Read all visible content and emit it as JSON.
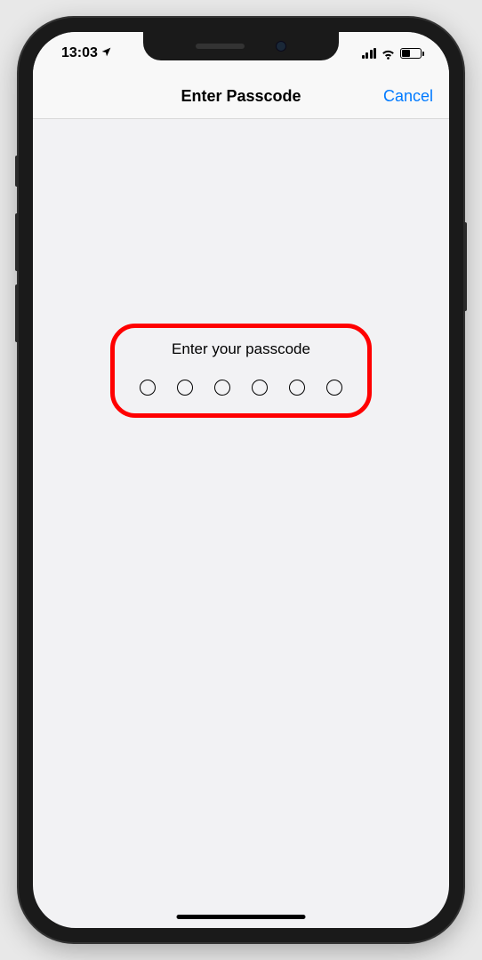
{
  "status_bar": {
    "time": "13:03",
    "location_icon": "location-arrow",
    "signal_icon": "cellular-signal",
    "wifi_icon": "wifi",
    "battery_icon": "battery-half"
  },
  "nav": {
    "title": "Enter Passcode",
    "cancel_label": "Cancel"
  },
  "content": {
    "prompt": "Enter your passcode",
    "passcode_length": 6
  },
  "colors": {
    "accent": "#007aff",
    "highlight": "#ff0000",
    "background": "#f2f2f4"
  }
}
